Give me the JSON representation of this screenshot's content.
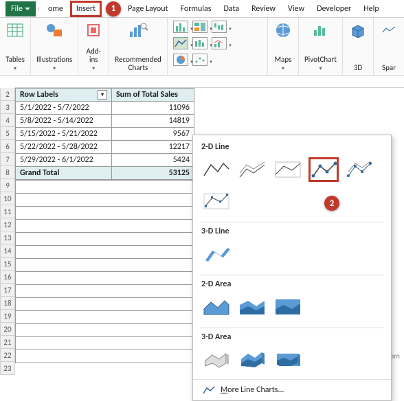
{
  "tabs": {
    "file": "File",
    "home": "ome",
    "insert": "Insert",
    "pagelayout": "Page Layout",
    "formulas": "Formulas",
    "data": "Data",
    "review": "Review",
    "view": "View",
    "developer": "Developer",
    "help": "Help"
  },
  "callouts": {
    "one": "1",
    "two": "2"
  },
  "ribbon": {
    "tables": "Tables",
    "illustrations": "Illustrations",
    "addins": "Add-\nins",
    "recommended": "Recommended\nCharts",
    "maps": "Maps",
    "pivotchart": "PivotChart",
    "threed": "3D",
    "spark": "Spar"
  },
  "pivot": {
    "headers": {
      "row": "Row Labels",
      "sum": "Sum of Total Sales"
    },
    "rows": [
      {
        "label": "5/1/2022 - 5/7/2022",
        "value": "11096"
      },
      {
        "label": "5/8/2022 - 5/14/2022",
        "value": "14819"
      },
      {
        "label": "5/15/2022 - 5/21/2022",
        "value": "9567"
      },
      {
        "label": "5/22/2022 - 5/28/2022",
        "value": "12217"
      },
      {
        "label": "5/29/2022 - 6/1/2022",
        "value": "5424"
      }
    ],
    "total": {
      "label": "Grand Total",
      "value": "53125"
    }
  },
  "rownums": [
    "2",
    "3",
    "4",
    "5",
    "6",
    "7",
    "8",
    "9",
    "10",
    "11",
    "12",
    "13",
    "14",
    "15",
    "16",
    "17",
    "18",
    "19",
    "20",
    "21",
    "22",
    "23"
  ],
  "gallery": {
    "g1": "2-D Line",
    "g2": "3-D Line",
    "g3": "2-D Area",
    "g4": "3-D Area",
    "more_prefix": "M",
    "more_text": "ore Line Charts..."
  },
  "watermark": "wsxdn.com"
}
